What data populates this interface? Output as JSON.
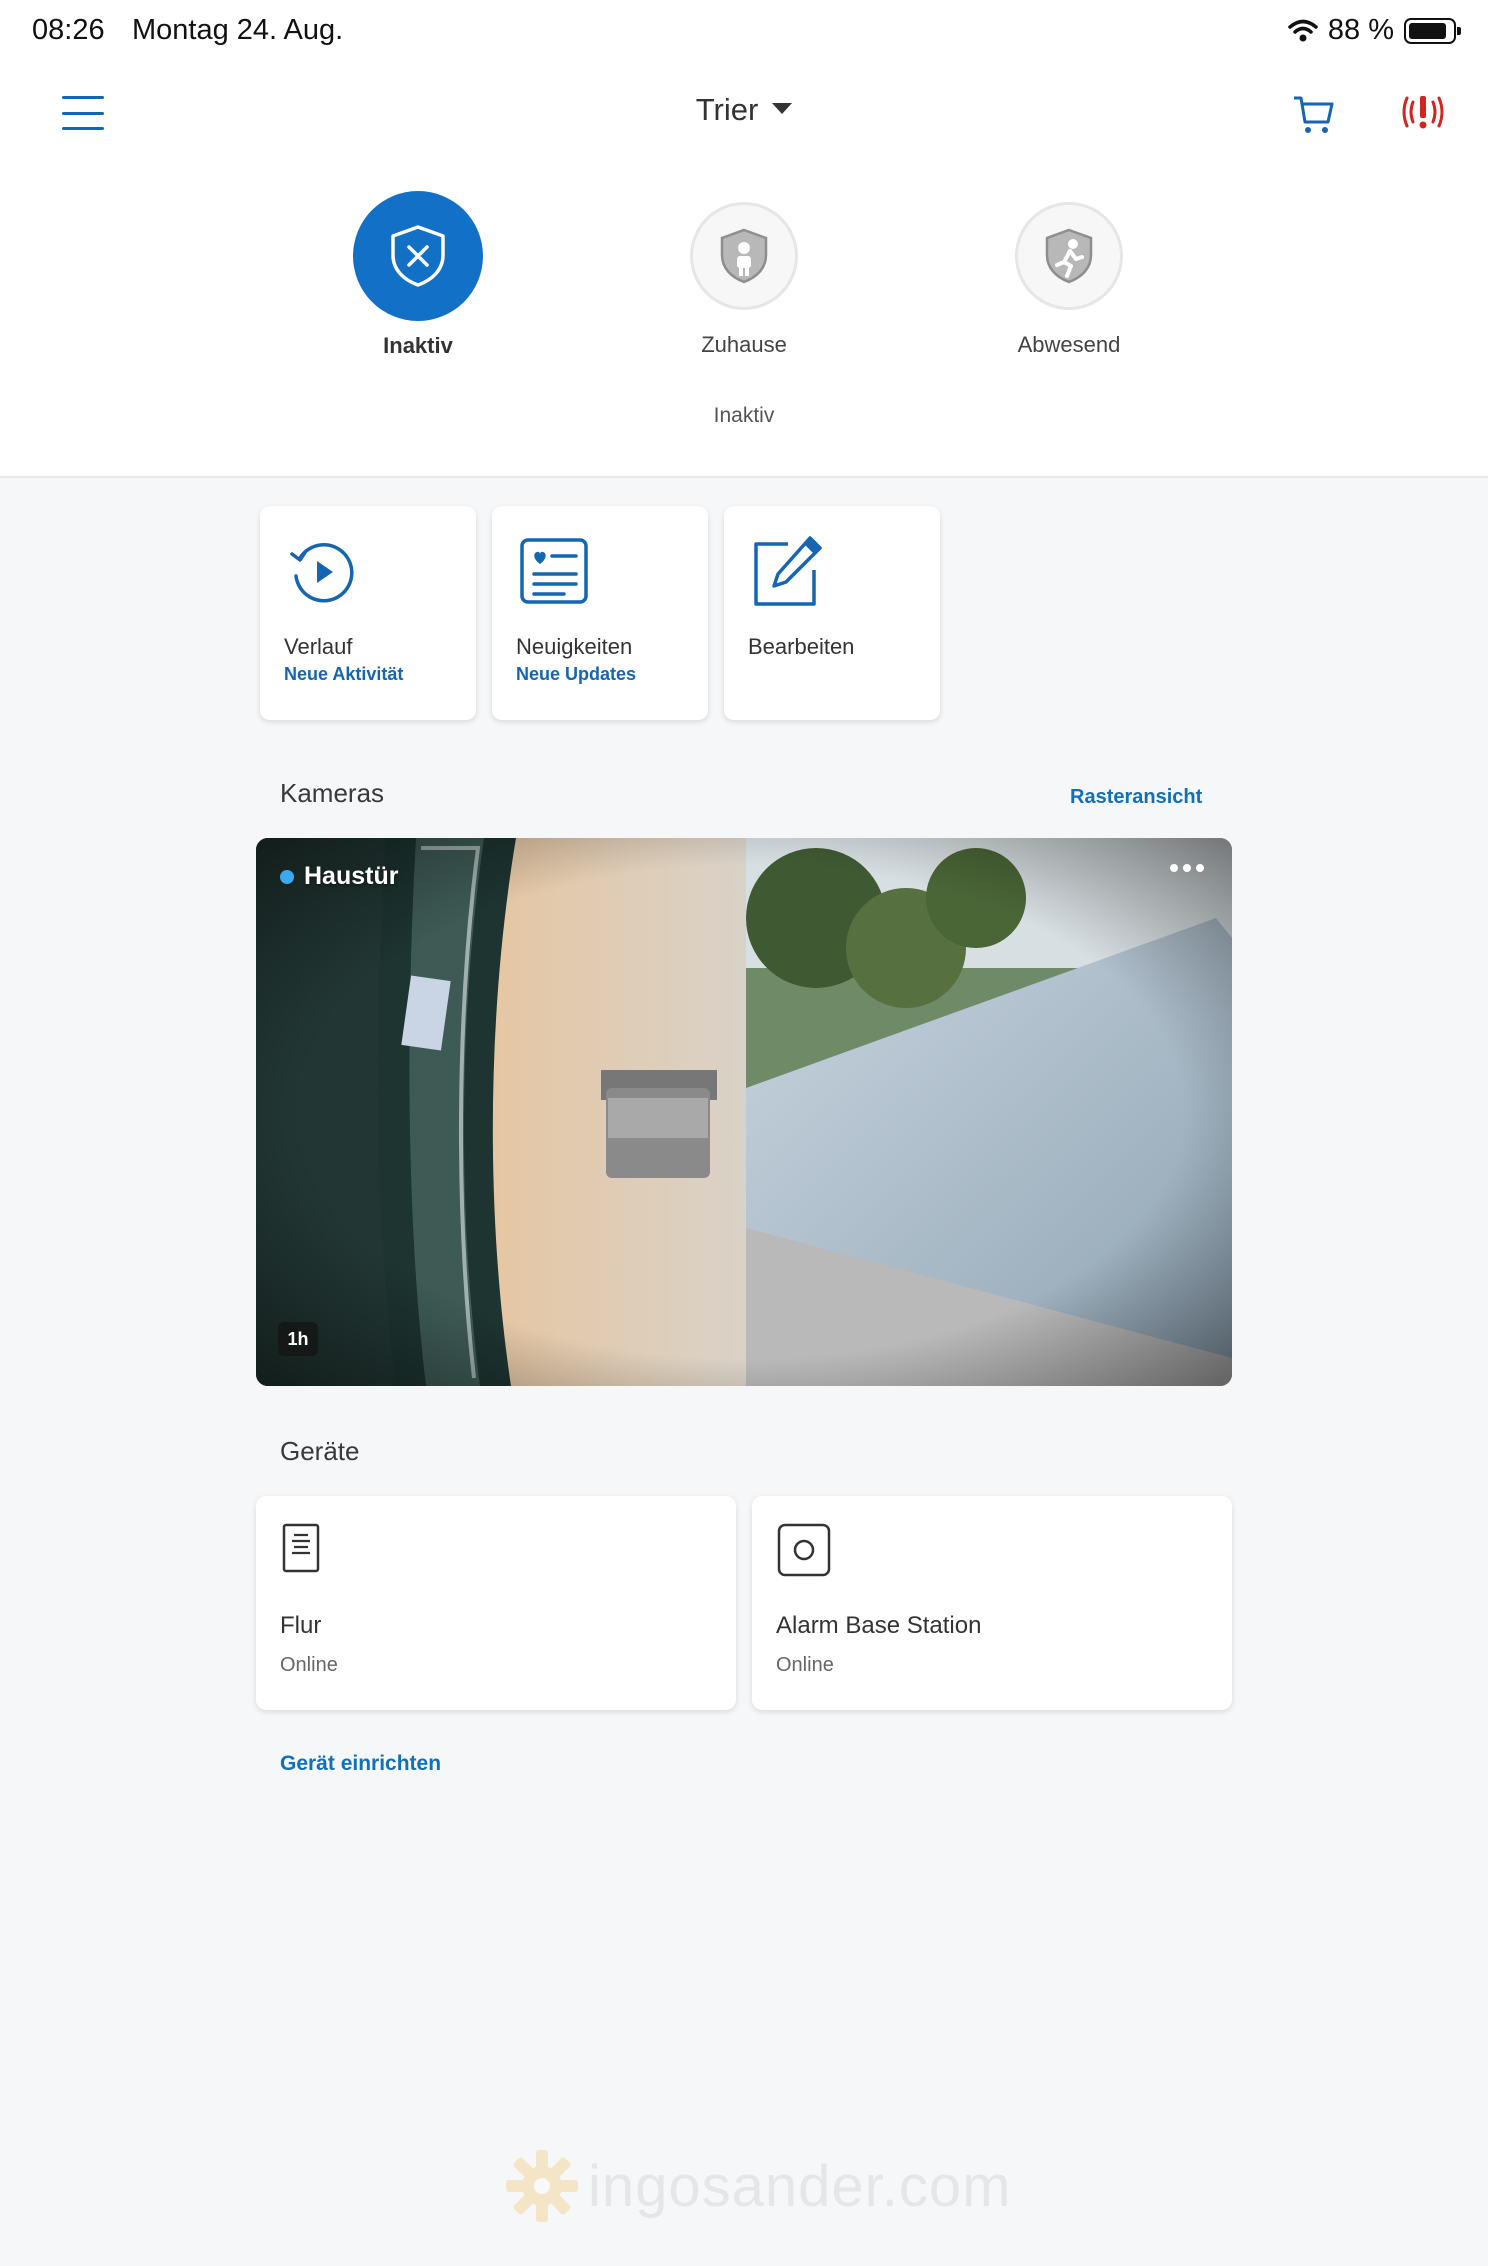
{
  "status_bar": {
    "time": "08:26",
    "date": "Montag 24. Aug.",
    "battery": "88 %",
    "battery_level": 0.88
  },
  "header": {
    "location": "Trier"
  },
  "modes": [
    {
      "label": "Inaktiv",
      "active": true
    },
    {
      "label": "Zuhause",
      "active": false
    },
    {
      "label": "Abwesend",
      "active": false
    }
  ],
  "mode_status": "Inaktiv",
  "tiles": [
    {
      "title": "Verlauf",
      "subtitle": "Neue Aktivität"
    },
    {
      "title": "Neuigkeiten",
      "subtitle": "Neue Updates"
    },
    {
      "title": "Bearbeiten",
      "subtitle": ""
    }
  ],
  "cameras": {
    "heading": "Kameras",
    "grid_link": "Rasteransicht",
    "camera": {
      "name": "Haustür",
      "age": "1h"
    }
  },
  "devices": {
    "heading": "Geräte",
    "items": [
      {
        "name": "Flur",
        "status": "Online"
      },
      {
        "name": "Alarm Base Station",
        "status": "Online"
      }
    ],
    "setup_link": "Gerät einrichten"
  },
  "watermark": "ingosander.com",
  "colors": {
    "accent": "#1270c7",
    "link": "#1270b8",
    "alarm": "#d0261e",
    "background": "#f6f7f9"
  }
}
